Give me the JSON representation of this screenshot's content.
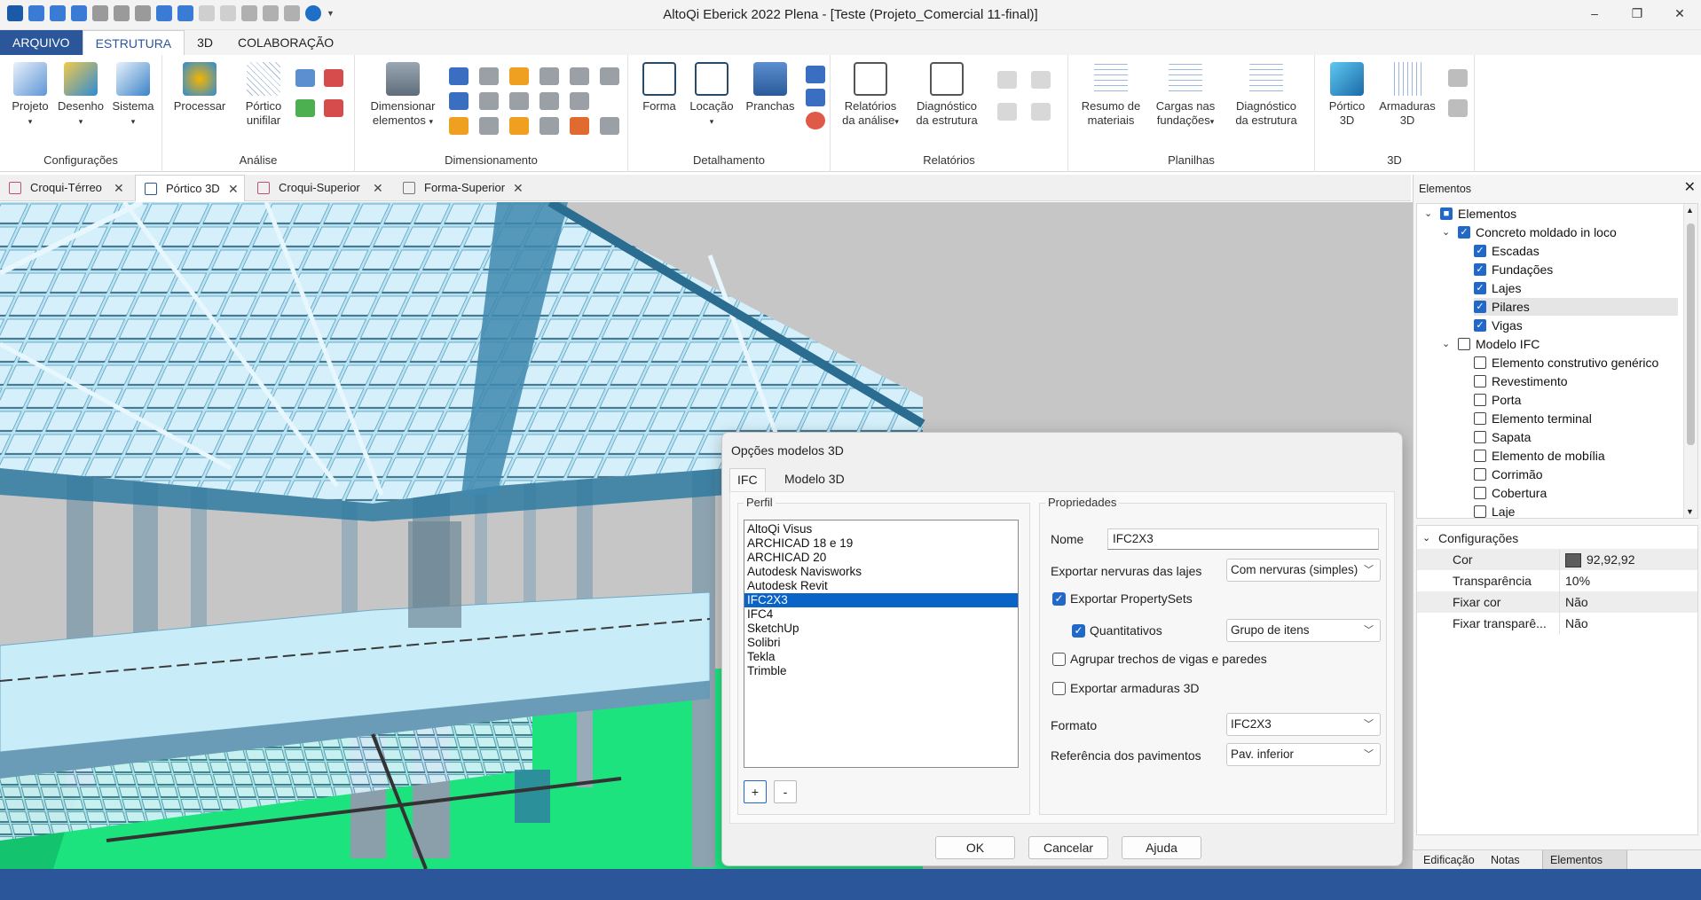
{
  "window": {
    "title": "AltoQi Eberick 2022 Plena - [Teste (Projeto_Comercial 11-final)]",
    "minimize": "–",
    "restore": "❐",
    "close": "✕"
  },
  "menu": {
    "tabs": [
      "ARQUIVO",
      "ESTRUTURA",
      "3D",
      "COLABORAÇÃO"
    ]
  },
  "ribbon": {
    "groups": {
      "configuracoes": "Configurações",
      "analise": "Análise",
      "dimensionamento": "Dimensionamento",
      "detalhamento": "Detalhamento",
      "relatorios": "Relatórios",
      "planilhas": "Planilhas",
      "g3d": "3D"
    },
    "buttons": {
      "projeto": "Projeto",
      "desenho": "Desenho",
      "sistema": "Sistema",
      "processar": "Processar",
      "portico_unifilar_1": "Pórtico",
      "portico_unifilar_2": "unifilar",
      "dimensionar_1": "Dimensionar",
      "dimensionar_2": "elementos",
      "forma": "Forma",
      "locacao": "Locação",
      "pranchas": "Pranchas",
      "relatorios_analise_1": "Relatórios",
      "relatorios_analise_2": "da análise",
      "diagnostico_1": "Diagnóstico",
      "diagnostico_2": "da estrutura",
      "resumo_1": "Resumo de",
      "resumo_2": "materiais",
      "cargas_1": "Cargas nas",
      "cargas_2": "fundações",
      "diag_est_1": "Diagnóstico",
      "diag_est_2": "da estrutura",
      "portico3d_1": "Pórtico",
      "portico3d_2": "3D",
      "armaduras_1": "Armaduras",
      "armaduras_2": "3D"
    }
  },
  "document_tabs": [
    "Croqui-Térreo",
    "Pórtico 3D",
    "Croqui-Superior",
    "Forma-Superior"
  ],
  "dialog": {
    "title": "Opções modelos 3D",
    "tabs": [
      "IFC",
      "Modelo 3D"
    ],
    "perfil_label": "Perfil",
    "profiles": [
      "AltoQi Visus",
      "ARCHICAD 18 e 19",
      "ARCHICAD 20",
      "Autodesk Navisworks",
      "Autodesk Revit",
      "IFC2X3",
      "IFC4",
      "SketchUp",
      "Solibri",
      "Tekla",
      "Trimble"
    ],
    "selected_profile": "IFC2X3",
    "add_button": "+",
    "remove_button": "-",
    "propriedades_label": "Propriedades",
    "nome_label": "Nome",
    "nome_value": "IFC2X3",
    "exportar_nervuras_label": "Exportar nervuras das lajes",
    "exportar_nervuras_value": "Com nervuras (simples)",
    "exportar_propertysets_label": "Exportar PropertySets",
    "quantitativos_label": "Quantitativos",
    "quantitativos_value": "Grupo de itens",
    "agrupar_label": "Agrupar trechos de vigas e paredes",
    "exportar_armaduras_label": "Exportar armaduras 3D",
    "formato_label": "Formato",
    "formato_value": "IFC2X3",
    "referencia_label": "Referência dos pavimentos",
    "referencia_value": "Pav. inferior",
    "ok": "OK",
    "cancel": "Cancelar",
    "help": "Ajuda"
  },
  "panel": {
    "title": "Elementos",
    "close": "✕",
    "tree": [
      {
        "label": "Elementos",
        "level": 0,
        "expanded": true,
        "checked": "partial"
      },
      {
        "label": "Concreto moldado in loco",
        "level": 1,
        "expanded": true,
        "checked": true
      },
      {
        "label": "Escadas",
        "level": 2,
        "checked": true
      },
      {
        "label": "Fundações",
        "level": 2,
        "checked": true
      },
      {
        "label": "Lajes",
        "level": 2,
        "checked": true
      },
      {
        "label": "Pilares",
        "level": 2,
        "checked": true,
        "highlighted": true
      },
      {
        "label": "Vigas",
        "level": 2,
        "checked": true
      },
      {
        "label": "Modelo IFC",
        "level": 1,
        "expanded": true,
        "checked": false
      },
      {
        "label": "Elemento construtivo genérico",
        "level": 2,
        "checked": false
      },
      {
        "label": "Revestimento",
        "level": 2,
        "checked": false
      },
      {
        "label": "Porta",
        "level": 2,
        "checked": false
      },
      {
        "label": "Elemento terminal",
        "level": 2,
        "checked": false
      },
      {
        "label": "Sapata",
        "level": 2,
        "checked": false
      },
      {
        "label": "Elemento de mobília",
        "level": 2,
        "checked": false
      },
      {
        "label": "Corrimão",
        "level": 2,
        "checked": false
      },
      {
        "label": "Cobertura",
        "level": 2,
        "checked": false
      },
      {
        "label": "Laje",
        "level": 2,
        "checked": false
      }
    ],
    "config_title": "Configurações",
    "properties": [
      {
        "key": "Cor",
        "value": "92,92,92",
        "swatch": "#5c5c5c"
      },
      {
        "key": "Transparência",
        "value": "10%"
      },
      {
        "key": "Fixar cor",
        "value": "Não"
      },
      {
        "key": "Fixar transparê...",
        "value": "Não"
      }
    ],
    "bottom_tabs": [
      "Edificação",
      "Notas",
      "Elementos"
    ]
  },
  "colors": {
    "accent": "#2b579a",
    "selection": "#0a64c8",
    "slab": "#bfe6f5",
    "column": "#8fa6b4",
    "ground": "#19e07c",
    "background3d": "#c8c8c8"
  }
}
